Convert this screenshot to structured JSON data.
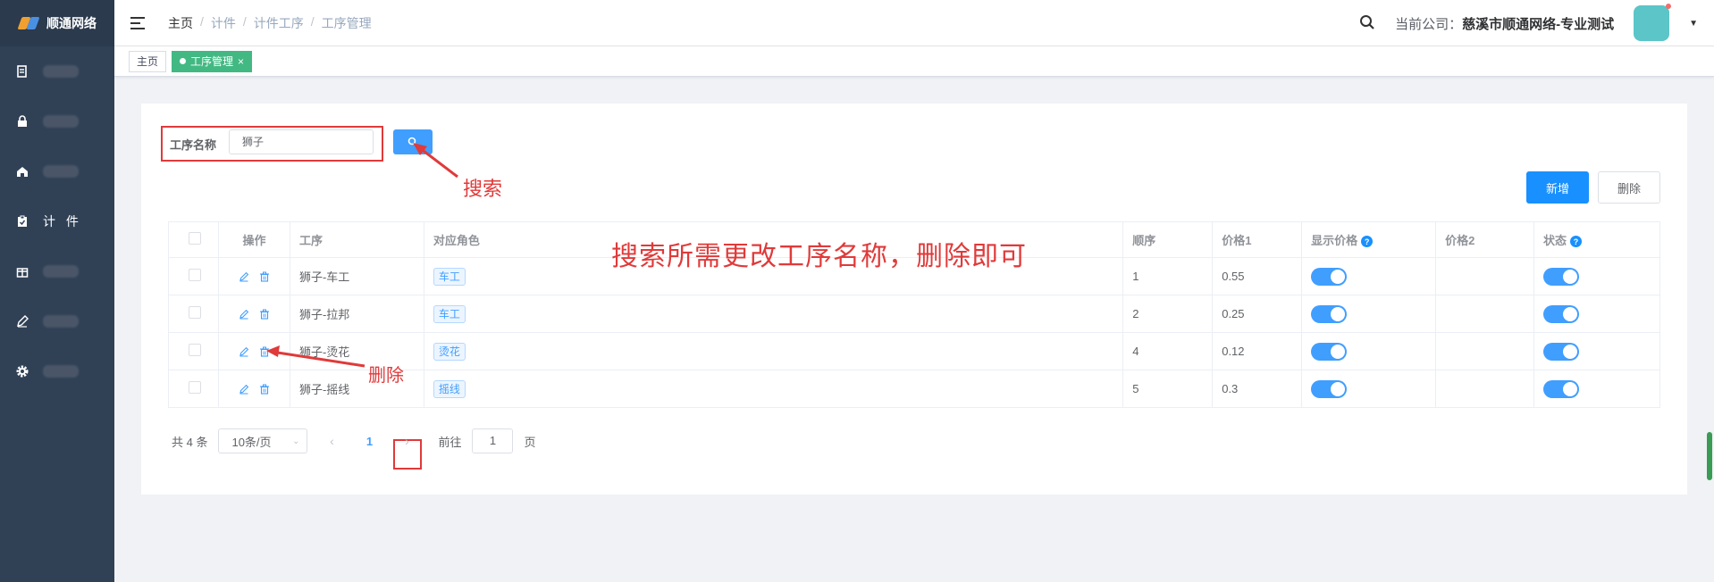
{
  "logo": {
    "text": "顺通网络"
  },
  "sidebar": {
    "items": [
      {
        "icon": "document-icon",
        "label": ""
      },
      {
        "icon": "lock-icon",
        "label": ""
      },
      {
        "icon": "home-icon",
        "label": ""
      },
      {
        "icon": "clipboard-icon",
        "label": "计 件"
      },
      {
        "icon": "gift-icon",
        "label": ""
      },
      {
        "icon": "pen-icon",
        "label": ""
      },
      {
        "icon": "gear-icon",
        "label": ""
      }
    ]
  },
  "header": {
    "breadcrumb": [
      "主页",
      "计件",
      "计件工序",
      "工序管理"
    ],
    "company_prefix": "当前公司：",
    "company_name": "慈溪市顺通网络-专业测试"
  },
  "tags": {
    "home": "主页",
    "active": "工序管理",
    "close": "×"
  },
  "search": {
    "label": "工序名称",
    "value": "狮子"
  },
  "buttons": {
    "add": "新增",
    "delete": "删除"
  },
  "table": {
    "headers": {
      "op": "操作",
      "process": "工序",
      "role": "对应角色",
      "seq": "顺序",
      "price1": "价格1",
      "show_price": "显示价格",
      "price2": "价格2",
      "status": "状态"
    },
    "rows": [
      {
        "process": "狮子-车工",
        "role": "车工",
        "seq": "1",
        "price1": "0.55",
        "price2": "",
        "show_price": true,
        "status": true
      },
      {
        "process": "狮子-拉邦",
        "role": "车工",
        "seq": "2",
        "price1": "0.25",
        "price2": "",
        "show_price": true,
        "status": true
      },
      {
        "process": "狮子-烫花",
        "role": "烫花",
        "seq": "4",
        "price1": "0.12",
        "price2": "",
        "show_price": true,
        "status": true
      },
      {
        "process": "狮子-摇线",
        "role": "摇线",
        "seq": "5",
        "price1": "0.3",
        "price2": "",
        "show_price": true,
        "status": true
      }
    ]
  },
  "pagination": {
    "total": "共 4 条",
    "page_size": "10条/页",
    "current": "1",
    "goto_prefix": "前往",
    "goto_value": "1",
    "goto_suffix": "页"
  },
  "annotations": {
    "search": "搜索",
    "main": "搜索所需更改工序名称，删除即可",
    "delete": "删除"
  },
  "colors": {
    "sidebar": "#304156",
    "primary": "#409eff",
    "active_tag": "#42b983",
    "annotation": "#e03a3a"
  }
}
